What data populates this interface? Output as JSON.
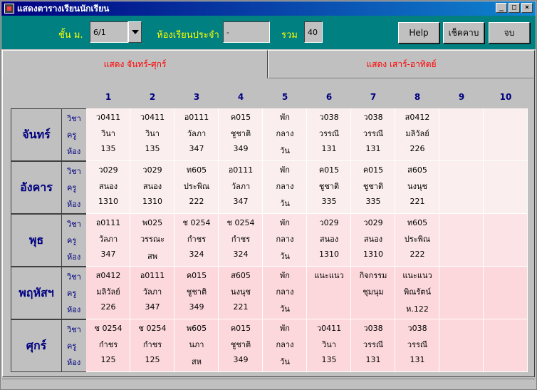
{
  "window": {
    "title": "แสดงตารางเรียนนักเรียน"
  },
  "toolbar": {
    "grade_label": "ชั้น ม.",
    "grade_value": "6/1",
    "homeroom_label": "ห้องเรียนประจำ",
    "homeroom_value": "-",
    "total_label": "รวม",
    "total_value": "40",
    "help_label": "Help",
    "check_label": "เช็คคาบ",
    "exit_label": "จบ"
  },
  "tabs": [
    {
      "label": "แสดง จันทร์-ศุกร์",
      "active": true
    },
    {
      "label": "แสดง เสาร์-อาทิตย์",
      "active": false
    }
  ],
  "periods": [
    "1",
    "2",
    "3",
    "4",
    "5",
    "6",
    "7",
    "8",
    "9",
    "10"
  ],
  "row_labels": {
    "subject": "วิชา",
    "teacher": "ครู",
    "room": "ห้อง"
  },
  "days": [
    {
      "name": "จันทร์",
      "cells": [
        [
          "ว0411",
          "วินา",
          "135"
        ],
        [
          "ว0411",
          "วินา",
          "135"
        ],
        [
          "อ0111",
          "วัลภา",
          "347"
        ],
        [
          "ค015",
          "ชูชาติ",
          "349"
        ],
        [
          "พัก",
          "กลาง",
          "วัน"
        ],
        [
          "ว038",
          "วรรณี",
          "131"
        ],
        [
          "ว038",
          "วรรณี",
          "131"
        ],
        [
          "ส0412",
          "มลิวัลย์",
          "226"
        ],
        [
          "",
          "",
          ""
        ],
        [
          "",
          "",
          ""
        ]
      ]
    },
    {
      "name": "อังคาร",
      "cells": [
        [
          "ว029",
          "สนอง",
          "1310"
        ],
        [
          "ว029",
          "สนอง",
          "1310"
        ],
        [
          "ท605",
          "ประพิณ",
          "222"
        ],
        [
          "อ0111",
          "วัลภา",
          "347"
        ],
        [
          "พัก",
          "กลาง",
          "วัน"
        ],
        [
          "ค015",
          "ชูชาติ",
          "335"
        ],
        [
          "ค015",
          "ชูชาติ",
          "335"
        ],
        [
          "ส605",
          "นงนุช",
          "221"
        ],
        [
          "",
          "",
          ""
        ],
        [
          "",
          "",
          ""
        ]
      ]
    },
    {
      "name": "พุธ",
      "cells": [
        [
          "อ0111",
          "วัลภา",
          "347"
        ],
        [
          "พ025",
          "วรรณะ",
          "สพ"
        ],
        [
          "ช 0254",
          "กำชร",
          "324"
        ],
        [
          "ช 0254",
          "กำชร",
          "324"
        ],
        [
          "พัก",
          "กลาง",
          "วัน"
        ],
        [
          "ว029",
          "สนอง",
          "1310"
        ],
        [
          "ว029",
          "สนอง",
          "1310"
        ],
        [
          "ท605",
          "ประพิณ",
          "222"
        ],
        [
          "",
          "",
          ""
        ],
        [
          "",
          "",
          ""
        ]
      ]
    },
    {
      "name": "พฤหัสฯ",
      "cells": [
        [
          "ส0412",
          "มลิวัลย์",
          "226"
        ],
        [
          "อ0111",
          "วัลภา",
          "347"
        ],
        [
          "ค015",
          "ชูชาติ",
          "349"
        ],
        [
          "ส605",
          "นงนุช",
          "221"
        ],
        [
          "พัก",
          "กลาง",
          "วัน"
        ],
        [
          "แนะแนว",
          "",
          ""
        ],
        [
          "กิจกรรม",
          "ชุมนุม",
          ""
        ],
        [
          "แนะแนว",
          "พิณรัตน์",
          "ห.122"
        ],
        [
          "",
          "",
          ""
        ],
        [
          "",
          "",
          ""
        ]
      ]
    },
    {
      "name": "ศุกร์",
      "cells": [
        [
          "ช 0254",
          "กำชร",
          "125"
        ],
        [
          "ช 0254",
          "กำชร",
          "125"
        ],
        [
          "พ605",
          "นภา",
          "สห"
        ],
        [
          "ค015",
          "ชูชาติ",
          "349"
        ],
        [
          "พัก",
          "กลาง",
          "วัน"
        ],
        [
          "ว0411",
          "วินา",
          "135"
        ],
        [
          "ว038",
          "วรรณี",
          "131"
        ],
        [
          "ว038",
          "วรรณี",
          "131"
        ],
        [
          "",
          "",
          ""
        ],
        [
          "",
          "",
          ""
        ]
      ]
    }
  ],
  "colors": {
    "titlebar": "#000080",
    "toolbar_bg": "#008080",
    "label_yellow": "#ffff00",
    "tab_text": "#ff0000",
    "day_text": "#000080",
    "cell_bg_top": "#fbeeee",
    "cell_bg_bottom": "#fcd8dc"
  }
}
